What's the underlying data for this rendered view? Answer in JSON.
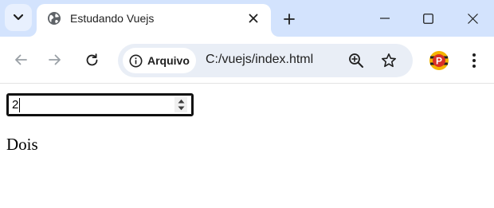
{
  "browser": {
    "tab": {
      "title": "Estudando Vuejs",
      "favicon": "globe-icon"
    },
    "new_tab_icon": "plus-icon",
    "window_controls": [
      "minimize-icon",
      "maximize-icon",
      "close-icon"
    ]
  },
  "toolbar": {
    "site_chip_label": "Arquivo",
    "url": "C:/vuejs/index.html",
    "icons": [
      "back-arrow-icon",
      "forward-arrow-icon",
      "reload-icon",
      "info-icon",
      "zoom-icon",
      "star-icon",
      "avatar",
      "kebab-menu-icon"
    ],
    "avatar_letter": "P"
  },
  "page": {
    "number_input_value": "2",
    "output_text": "Dois"
  },
  "colors": {
    "tabstrip_bg": "#d3e3fd",
    "omnibox_bg": "#e9eef6",
    "avatar_bg": "#d93025"
  }
}
